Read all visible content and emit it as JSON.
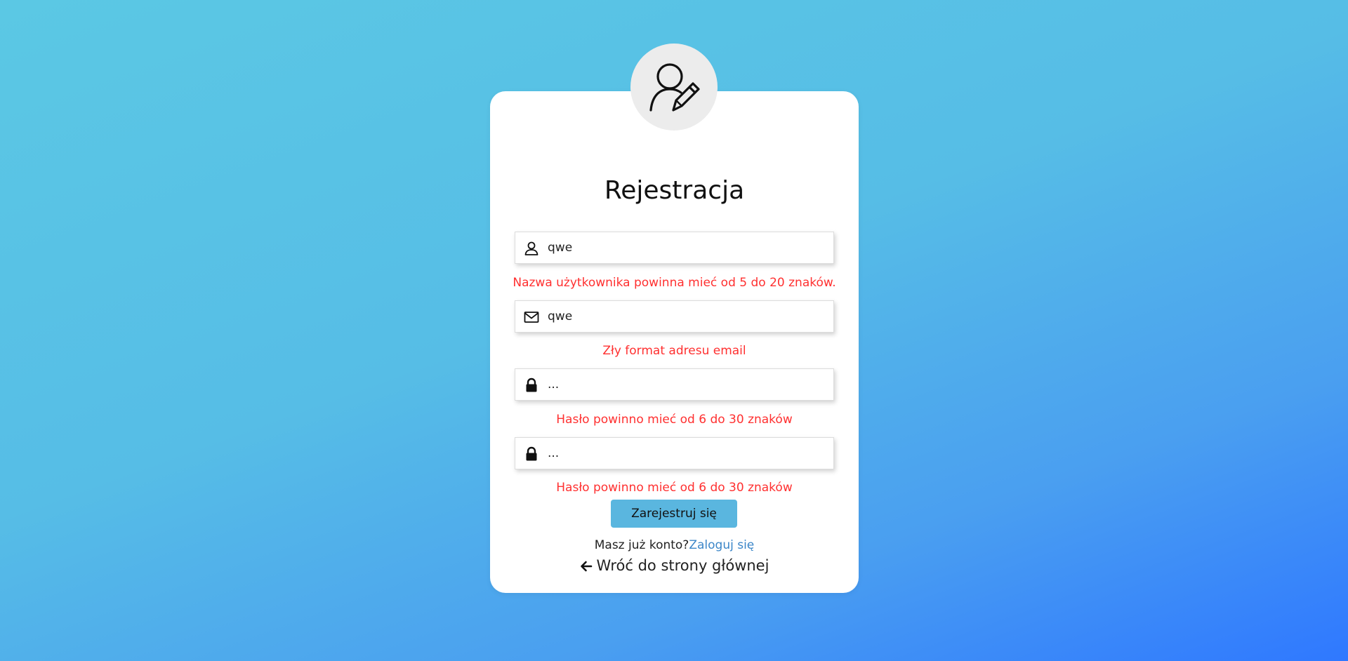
{
  "form": {
    "title": "Rejestracja",
    "username": {
      "value": "qwe",
      "error": "Nazwa użytkownika powinna mieć od 5 do 20 znaków."
    },
    "email": {
      "value": "qwe",
      "error": "Zły format adresu email"
    },
    "password": {
      "value": "...",
      "error": "Hasło powinno mieć od 6 do 30 znaków"
    },
    "password_confirm": {
      "value": "...",
      "error": "Hasło powinno mieć od 6 do 30 znaków"
    },
    "submit_label": "Zarejestruj się",
    "have_account_text": "Masz już konto?",
    "login_link": "Zaloguj się",
    "back_link": "Wróć do strony głównej"
  },
  "icons": {
    "avatar": "user-edit-icon",
    "username": "user-icon",
    "email": "envelope-icon",
    "password": "lock-icon",
    "password_confirm": "lock-icon",
    "back": "arrow-left-icon"
  },
  "colors": {
    "error": "#ff3030",
    "button": "#5ab6df",
    "link": "#3b86c8",
    "background_start": "#5bc8e4",
    "background_end": "#2f78ff"
  }
}
